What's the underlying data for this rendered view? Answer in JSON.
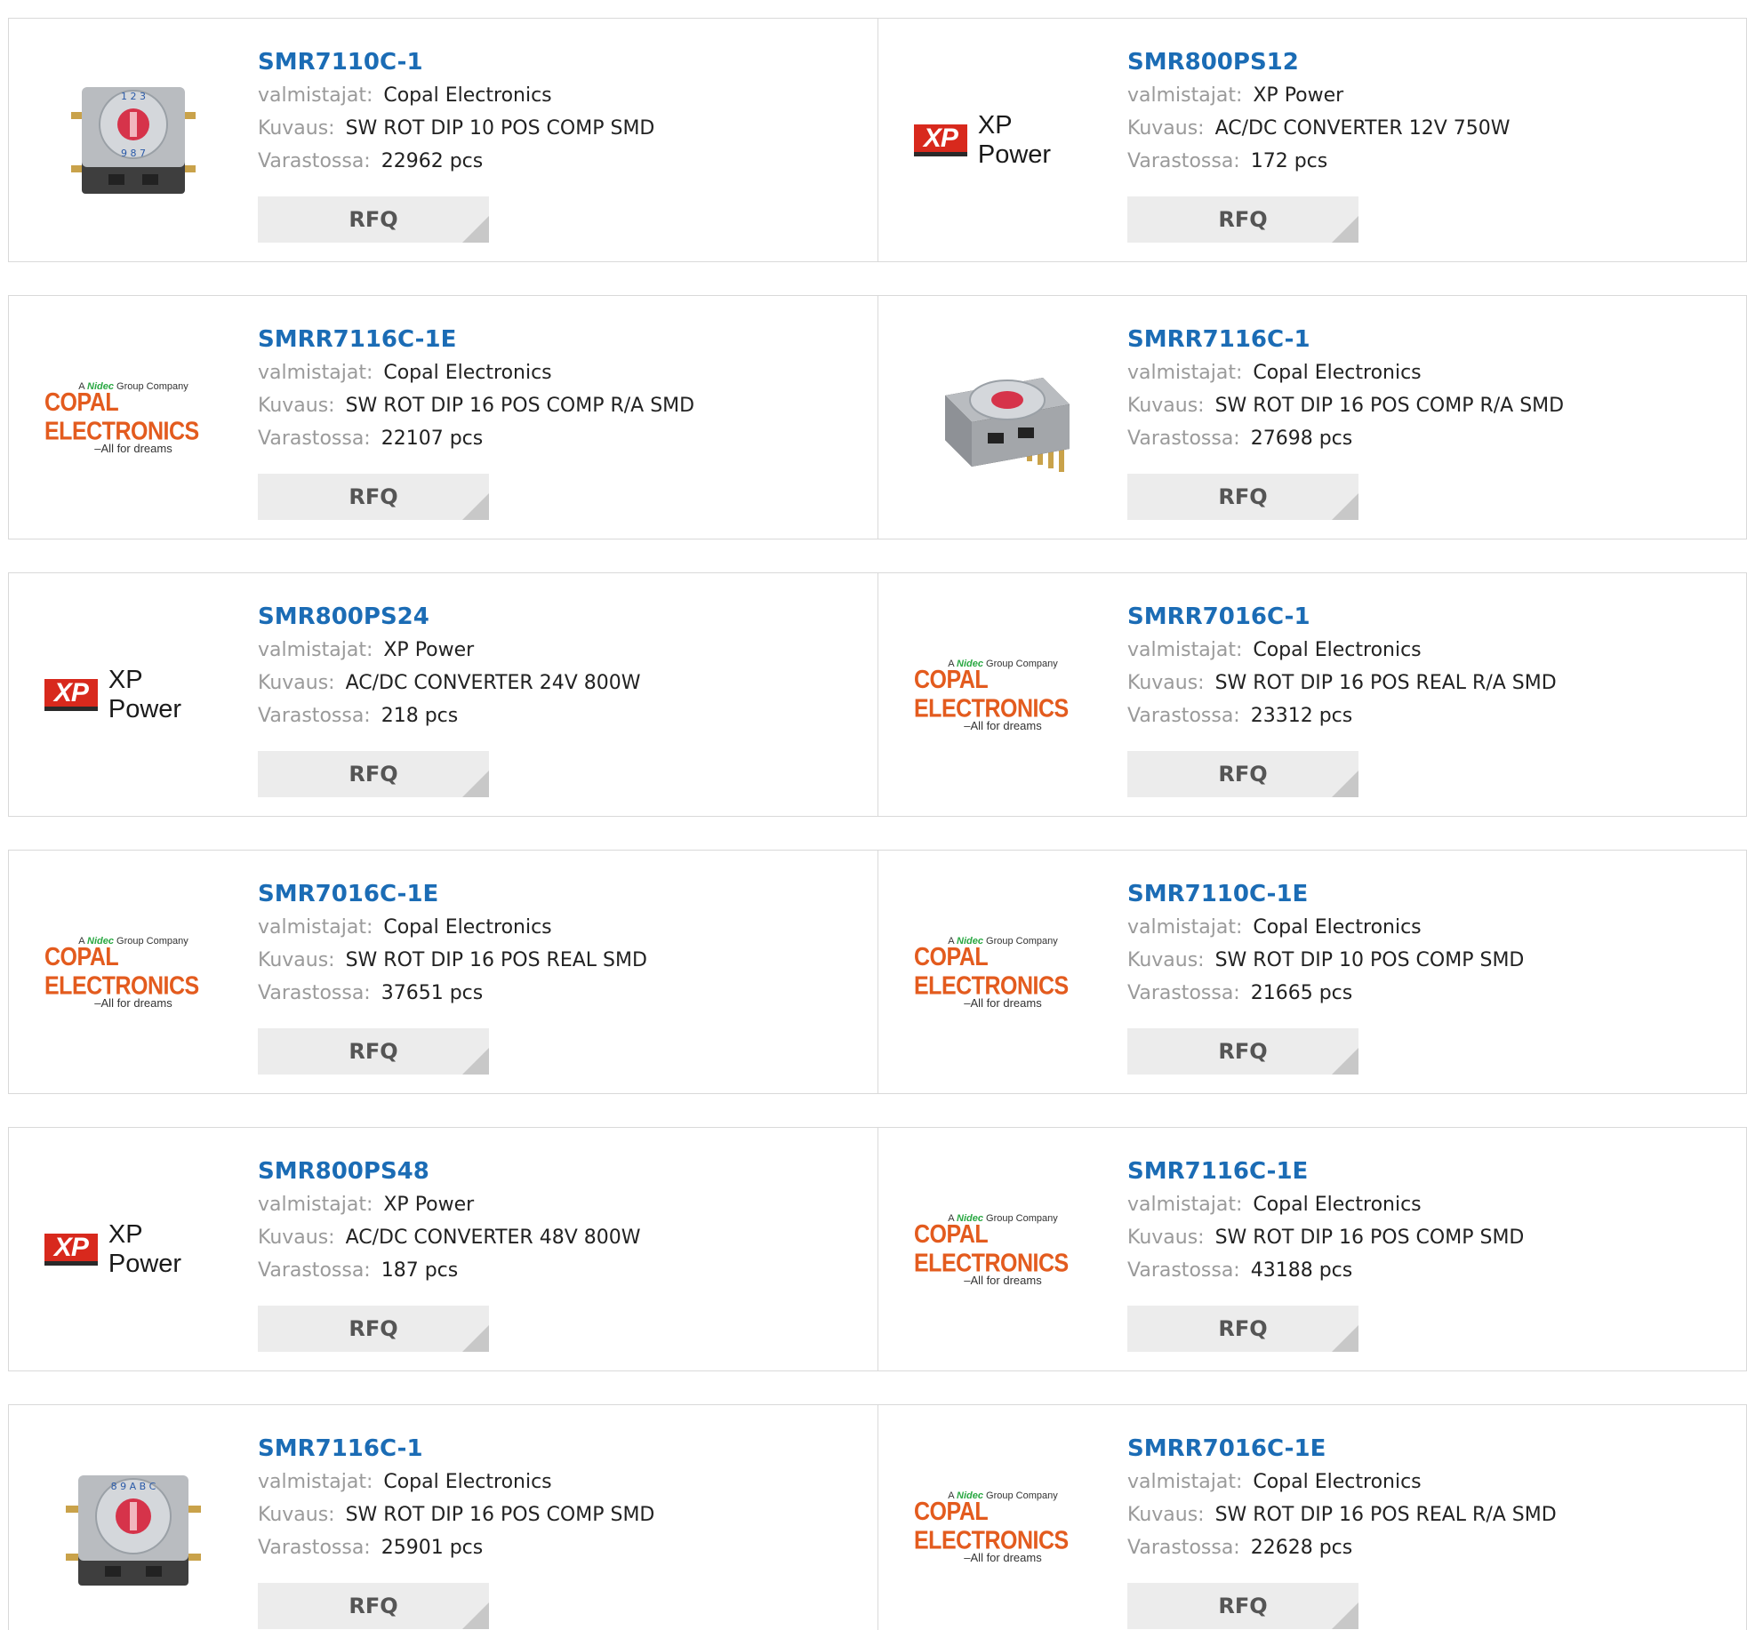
{
  "labels": {
    "manufacturer": "valmistajat:",
    "description": "Kuvaus:",
    "stock": "Varastossa:",
    "rfq": "RFQ"
  },
  "logos": {
    "xp_mark": "XP",
    "xp_text": "XP Power",
    "copal_top_a": "A",
    "copal_top_nidec": "Nidec",
    "copal_top_rest": "Group Company",
    "copal_main": "COPAL ELECTRONICS",
    "copal_tag": "–All for dreams"
  },
  "colors": {
    "link": "#1b6cb5",
    "label": "#9a9a9a",
    "button_bg": "#ececec",
    "copal_orange": "#e35b1e",
    "xp_red": "#d8291d"
  },
  "products": [
    {
      "pn": "SMR7110C-1",
      "manufacturer": "Copal Electronics",
      "description": "SW ROT DIP 10 POS COMP SMD",
      "stock": "22962 pcs",
      "image": "rotary-switch-10pos-photo"
    },
    {
      "pn": "SMR800PS12",
      "manufacturer": "XP Power",
      "description": "AC/DC CONVERTER 12V 750W",
      "stock": "172 pcs",
      "image": "xp-power-logo"
    },
    {
      "pn": "SMRR7116C-1E",
      "manufacturer": "Copal Electronics",
      "description": "SW ROT DIP 16 POS COMP R/A SMD",
      "stock": "22107 pcs",
      "image": "copal-electronics-logo"
    },
    {
      "pn": "SMRR7116C-1",
      "manufacturer": "Copal Electronics",
      "description": "SW ROT DIP 16 POS COMP R/A SMD",
      "stock": "27698 pcs",
      "image": "rotary-switch-16pos-ra-photo"
    },
    {
      "pn": "SMR800PS24",
      "manufacturer": "XP Power",
      "description": "AC/DC CONVERTER 24V 800W",
      "stock": "218 pcs",
      "image": "xp-power-logo"
    },
    {
      "pn": "SMRR7016C-1",
      "manufacturer": "Copal Electronics",
      "description": "SW ROT DIP 16 POS REAL R/A SMD",
      "stock": "23312 pcs",
      "image": "copal-electronics-logo"
    },
    {
      "pn": "SMR7016C-1E",
      "manufacturer": "Copal Electronics",
      "description": "SW ROT DIP 16 POS REAL SMD",
      "stock": "37651 pcs",
      "image": "copal-electronics-logo"
    },
    {
      "pn": "SMR7110C-1E",
      "manufacturer": "Copal Electronics",
      "description": "SW ROT DIP 10 POS COMP SMD",
      "stock": "21665 pcs",
      "image": "copal-electronics-logo"
    },
    {
      "pn": "SMR800PS48",
      "manufacturer": "XP Power",
      "description": "AC/DC CONVERTER 48V 800W",
      "stock": "187 pcs",
      "image": "xp-power-logo"
    },
    {
      "pn": "SMR7116C-1E",
      "manufacturer": "Copal Electronics",
      "description": "SW ROT DIP 16 POS COMP SMD",
      "stock": "43188 pcs",
      "image": "copal-electronics-logo"
    },
    {
      "pn": "SMR7116C-1",
      "manufacturer": "Copal Electronics",
      "description": "SW ROT DIP 16 POS COMP SMD",
      "stock": "25901 pcs",
      "image": "rotary-switch-16pos-photo"
    },
    {
      "pn": "SMRR7016C-1E",
      "manufacturer": "Copal Electronics",
      "description": "SW ROT DIP 16 POS REAL R/A SMD",
      "stock": "22628 pcs",
      "image": "copal-electronics-logo"
    }
  ]
}
